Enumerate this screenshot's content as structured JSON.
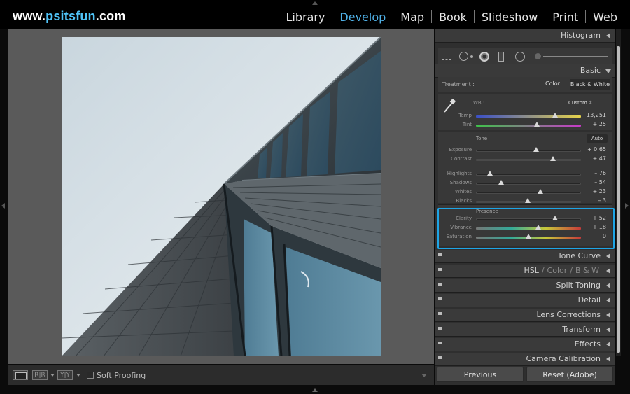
{
  "brand": {
    "prefix": "www.",
    "name": "psitsfun",
    "suffix": ".com"
  },
  "modules": [
    {
      "label": "Library",
      "active": false
    },
    {
      "label": "Develop",
      "active": true
    },
    {
      "label": "Map",
      "active": false
    },
    {
      "label": "Book",
      "active": false
    },
    {
      "label": "Slideshow",
      "active": false
    },
    {
      "label": "Print",
      "active": false
    },
    {
      "label": "Web",
      "active": false
    }
  ],
  "toolbar": {
    "soft_proofing_label": "Soft Proofing",
    "soft_proofing_checked": false,
    "compare_label": "R|R",
    "survey_label": "Y|Y"
  },
  "panels": {
    "histogram": "Histogram",
    "basic": "Basic",
    "tone_curve": "Tone Curve",
    "hsl_parts": [
      "HSL",
      "/",
      "Color",
      "/",
      "B & W"
    ],
    "split_toning": "Split Toning",
    "detail": "Detail",
    "lens_corrections": "Lens Corrections",
    "transform": "Transform",
    "effects": "Effects",
    "camera_calibration": "Camera Calibration"
  },
  "basic": {
    "treatment_label": "Treatment :",
    "treatment_color": "Color",
    "treatment_bw": "Black & White",
    "wb_label": "WB :",
    "wb_value": "Custom",
    "tone_label": "Tone",
    "auto_label": "Auto",
    "presence_label": "Presence",
    "wb_sliders": [
      {
        "label": "Temp",
        "value": "13,251",
        "pos": 0.75
      },
      {
        "label": "Tint",
        "value": "+ 25",
        "pos": 0.58
      }
    ],
    "tone_sliders": [
      {
        "label": "Exposure",
        "value": "+ 0.65",
        "pos": 0.57
      },
      {
        "label": "Contrast",
        "value": "+ 47",
        "pos": 0.73
      }
    ],
    "range_sliders": [
      {
        "label": "Highlights",
        "value": "– 76",
        "pos": 0.13
      },
      {
        "label": "Shadows",
        "value": "– 54",
        "pos": 0.24
      },
      {
        "label": "Whites",
        "value": "+ 23",
        "pos": 0.61
      },
      {
        "label": "Blacks",
        "value": "– 3",
        "pos": 0.49
      }
    ],
    "presence_sliders": [
      {
        "label": "Clarity",
        "value": "+ 52",
        "pos": 0.75
      },
      {
        "label": "Vibrance",
        "value": "+ 18",
        "pos": 0.59
      },
      {
        "label": "Saturation",
        "value": "0",
        "pos": 0.5
      }
    ]
  },
  "buttons": {
    "previous": "Previous",
    "reset": "Reset (Adobe)"
  },
  "colors": {
    "accent": "#4fb0e6",
    "highlight_box": "#1ea5e6"
  }
}
